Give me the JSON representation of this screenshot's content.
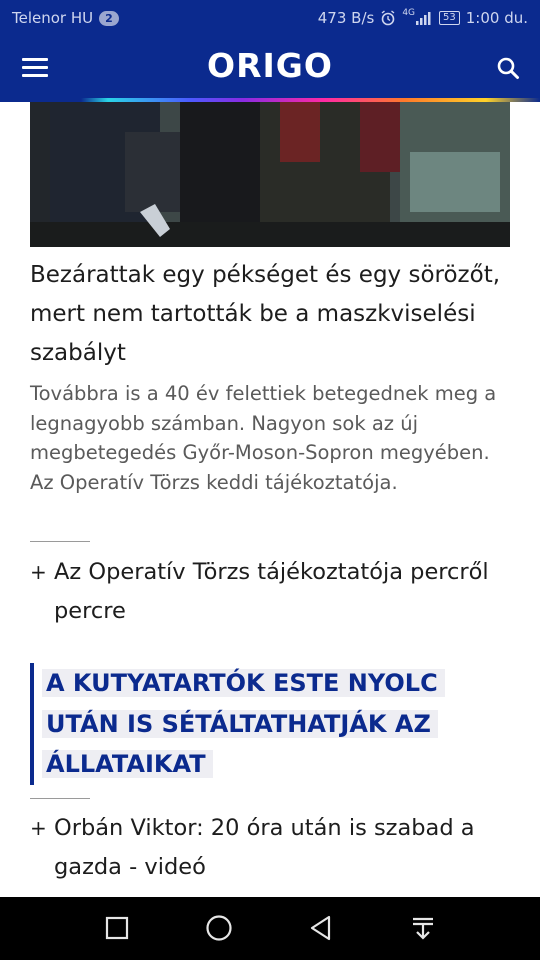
{
  "status_bar": {
    "carrier": "Telenor HU",
    "carrier_badge": "2",
    "net_speed": "473 B/s",
    "network": "4G",
    "battery": "53",
    "time": "1:00 du."
  },
  "header": {
    "logo": "ORIGO",
    "icons": [
      "hamburger-menu-icon",
      "search-icon"
    ],
    "brand_color": "#0b2a8e"
  },
  "article": {
    "headline": "Bezárattak egy pékséget és egy sörözőt, mert nem tartották be a maszkviselési szabályt",
    "lead": "Továbbra is a 40 év felettiek betegednek meg a legnagyobb számban. Nagyon sok az új megbetegedés Győr-Moson-Sopron megyében. Az Operatív Törzs keddi tájékoztatója."
  },
  "related_1": {
    "bullet": "+",
    "text": "Az Operatív Törzs tájékoztatója percről percre"
  },
  "highlight": {
    "line1": "A KUTYATARTÓK ESTE NYOLC",
    "line2": "UTÁN IS SÉTÁLTATHATJÁK AZ",
    "line3": "ÁLLATAIKAT"
  },
  "related_2": {
    "bullet": "+",
    "text": "Orbán Viktor: 20 óra után is szabad a gazda - videó"
  },
  "nav_bar": {
    "icons": [
      "recents-square-icon",
      "home-circle-icon",
      "back-triangle-icon",
      "notification-pull-down-icon"
    ]
  }
}
